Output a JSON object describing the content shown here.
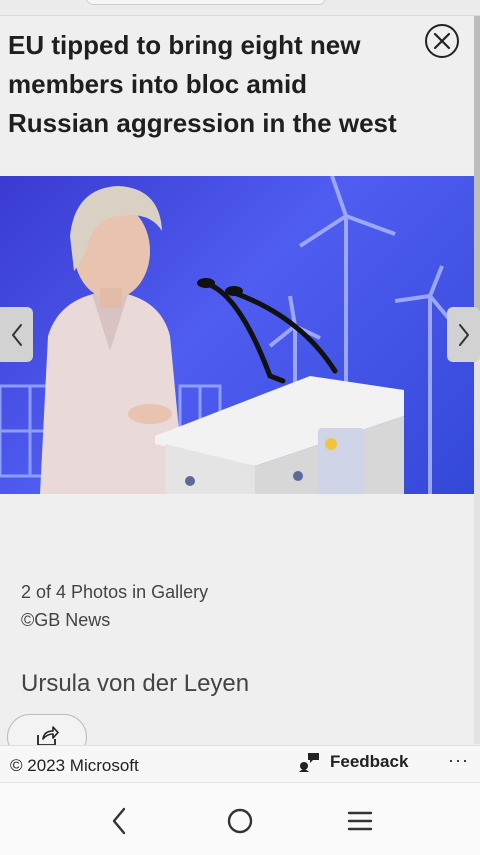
{
  "article": {
    "title": "EU tipped to bring eight new members into bloc amid Russian aggression in the west"
  },
  "gallery": {
    "position": "2 of 4 Photos in Gallery",
    "credit": "©GB News",
    "caption": "Ursula von der Leyen"
  },
  "footer": {
    "copyright": "© 2023 Microsoft",
    "feedback_label": "Feedback",
    "more_label": "···"
  },
  "icons": {
    "close": "close-icon",
    "prev": "chevron-left-icon",
    "next": "chevron-right-icon",
    "share": "share-icon",
    "feedback": "feedback-icon",
    "back": "back-icon",
    "home": "home-icon",
    "menu": "menu-icon"
  },
  "colors": {
    "photo_background": "#3f4fe0",
    "page_background": "#efefef"
  }
}
